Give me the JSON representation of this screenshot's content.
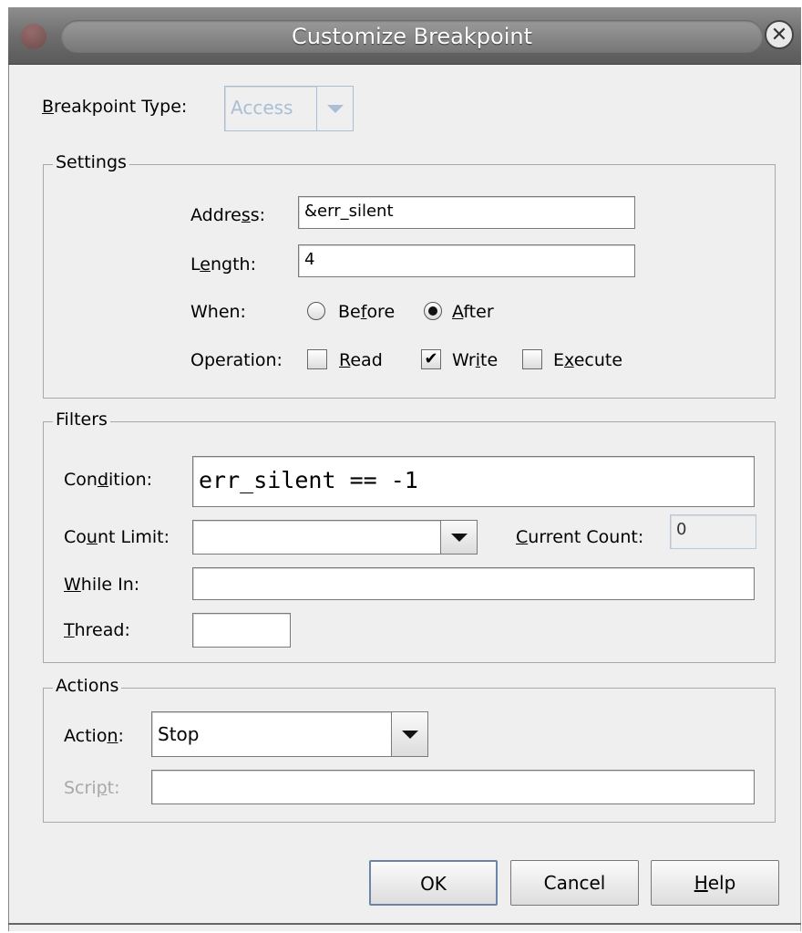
{
  "window": {
    "title": "Customize Breakpoint",
    "close_icon": "close-icon"
  },
  "breakpoint_type": {
    "label_prefix": "",
    "label_mnemonic": "B",
    "label_rest": "reakpoint Type:",
    "value": "Access"
  },
  "settings": {
    "group_title": "Settings",
    "address": {
      "label_a": "Addre",
      "label_m": "s",
      "label_b": "s:",
      "value": "&err_silent"
    },
    "length": {
      "label_a": "L",
      "label_m": "e",
      "label_b": "ngth:",
      "value": "4"
    },
    "when": {
      "label": "When:",
      "before_a": "Be",
      "before_m": "f",
      "before_b": "ore",
      "before_selected": false,
      "after_m": "A",
      "after_b": "fter",
      "after_selected": true
    },
    "operation": {
      "label": "Operation:",
      "read_m": "R",
      "read_b": "ead",
      "read_checked": false,
      "write_a": "Wr",
      "write_m": "i",
      "write_b": "te",
      "write_checked": true,
      "check_glyph": "✔",
      "execute_a": "E",
      "execute_m": "x",
      "execute_b": "ecute",
      "execute_checked": false
    }
  },
  "filters": {
    "group_title": "Filters",
    "condition": {
      "label_a": "Con",
      "label_m": "d",
      "label_b": "ition:",
      "value": "err_silent == -1"
    },
    "count_limit": {
      "label_a": "Co",
      "label_m": "u",
      "label_b": "nt Limit:",
      "value": ""
    },
    "current_count": {
      "label_m": "C",
      "label_b": "urrent Count:",
      "value": "0"
    },
    "while_in": {
      "label_m": "W",
      "label_b": "hile In:",
      "value": ""
    },
    "thread": {
      "label_m": "T",
      "label_b": "hread:",
      "value": ""
    }
  },
  "actions": {
    "group_title": "Actions",
    "action": {
      "label_a": "Actio",
      "label_m": "n",
      "label_b": ":",
      "value": "Stop"
    },
    "script": {
      "label_a": "Scri",
      "label_m": "p",
      "label_b": "t:",
      "value": ""
    }
  },
  "buttons": {
    "ok": "OK",
    "cancel": "Cancel",
    "help_m": "H",
    "help_b": "elp"
  }
}
